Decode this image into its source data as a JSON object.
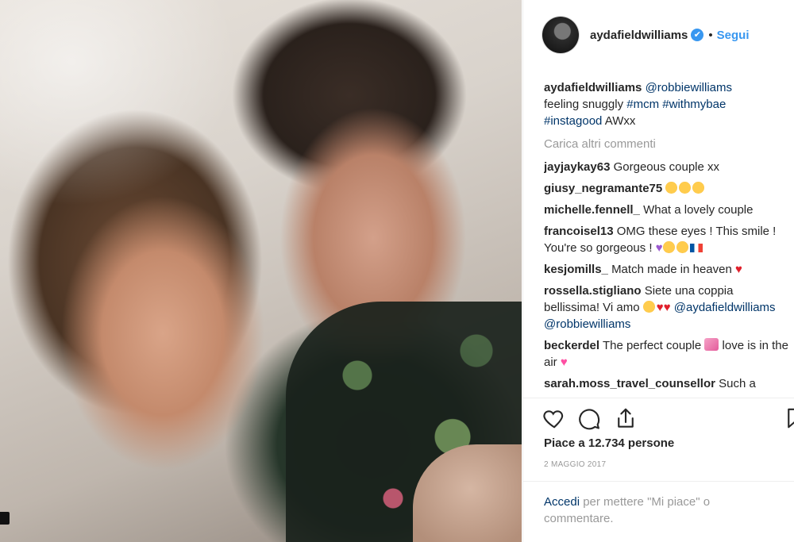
{
  "post": {
    "username": "aydafieldwilliams",
    "verified_icon": "✔",
    "separator": "•",
    "follow_label": "Segui",
    "caption": {
      "author": "aydafieldwilliams",
      "mention": "@robbiewilliams",
      "text1": "feeling snuggly",
      "hashtag1": "#mcm",
      "hashtag2": "#withmybae",
      "hashtag3": "#instagood",
      "text2": "AWxx"
    },
    "load_more": "Carica altri commenti",
    "comments": [
      {
        "user": "jayjaykay63",
        "text": "Gorgeous couple xx"
      },
      {
        "user": "giusy_negramante75",
        "text": ""
      },
      {
        "user": "michelle.fennell_",
        "text": "What a lovely couple"
      },
      {
        "user": "francoisel13",
        "text": "OMG these eyes ! This smile ! You're so gorgeous !"
      },
      {
        "user": "kesjomills_",
        "text": "Match made in heaven"
      },
      {
        "user": "rossella.stigliano",
        "text": "Siete una coppia bellissima! Vi amo",
        "mention1": "@aydafieldwilliams",
        "mention2": "@robbiewilliams"
      },
      {
        "user": "beckerdel",
        "text": "The perfect couple",
        "text2": "love is in the air"
      },
      {
        "user": "sarah.moss_travel_counsellor",
        "text": "Such a"
      }
    ],
    "likes": "Piace a 12.734 persone",
    "date": "2 MAGGIO 2017",
    "login_link": "Accedi",
    "login_text": " per mettere \"Mi piace\" o commentare."
  },
  "icons": [
    "heart-icon",
    "comment-icon",
    "share-icon",
    "bookmark-icon"
  ],
  "colors": {
    "link": "#003569",
    "accent": "#3897f0",
    "muted": "#999999"
  }
}
